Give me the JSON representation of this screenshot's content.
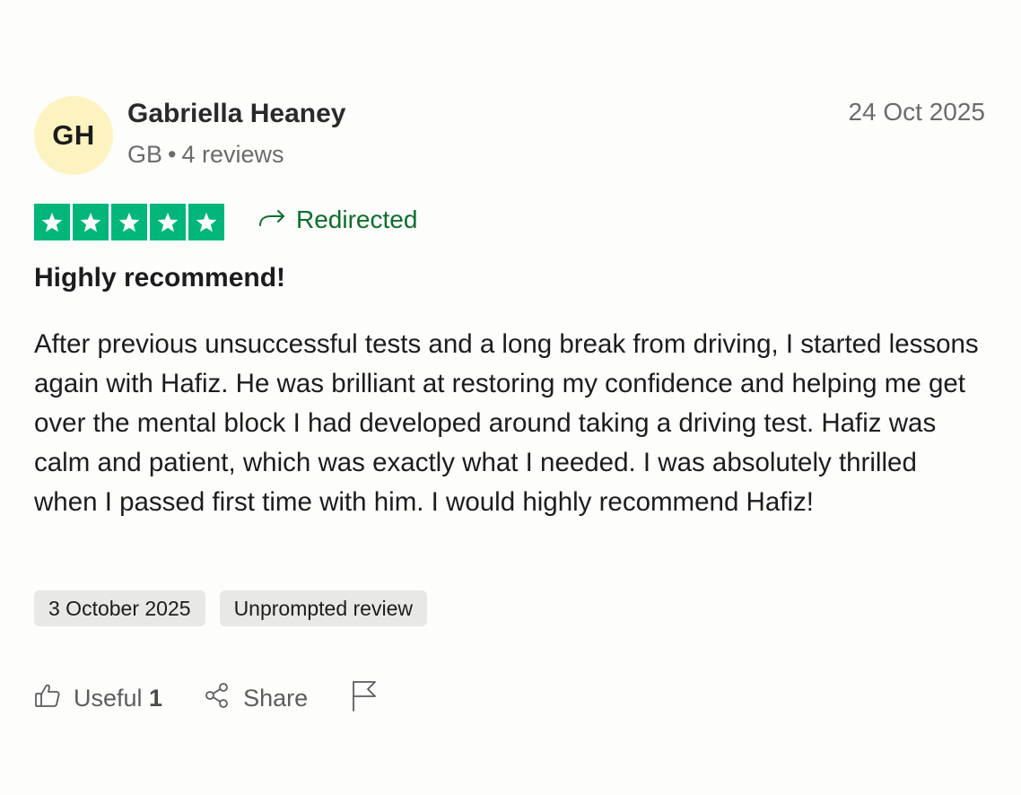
{
  "reviewer": {
    "initials": "GH",
    "name": "Gabriella Heaney",
    "country": "GB",
    "separator": "•",
    "review_count": "4 reviews"
  },
  "review": {
    "posted_date": "24 Oct 2025",
    "rating": 5,
    "rating_max": 5,
    "star_color": "#00b67a",
    "status_label": "Redirected",
    "status_color": "#0d6e2c",
    "title": "Highly recommend!",
    "body": "After previous unsuccessful tests and a long break from driving, I started lessons again with Hafiz. He was brilliant at restoring my confidence and helping me get over the mental block I had developed around taking a driving test. Hafiz was calm and patient, which was exactly what I needed. I was absolutely thrilled when I passed first time with him. I would highly recommend Hafiz!",
    "tags": [
      "3 October 2025",
      "Unprompted review"
    ]
  },
  "actions": {
    "useful_label": "Useful",
    "useful_count": "1",
    "share_label": "Share",
    "icons": [
      "thumbs-up-icon",
      "share-icon",
      "flag-icon"
    ]
  }
}
